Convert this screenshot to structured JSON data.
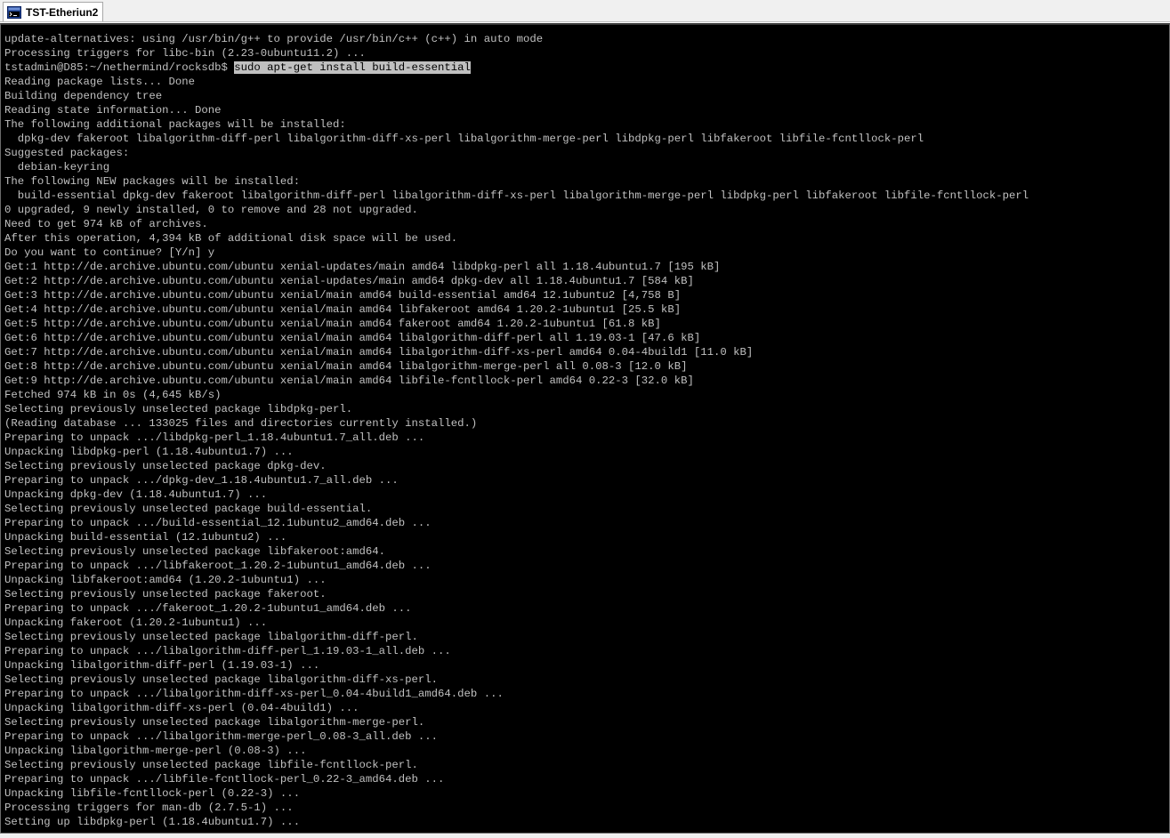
{
  "window": {
    "tab_title": "TST-Etheriun2",
    "tab_icon": "terminal-session-icon"
  },
  "colors": {
    "terminal_bg": "#000000",
    "terminal_fg": "#c0c0c0",
    "selection_bg": "#c0c0c0",
    "selection_fg": "#000000"
  },
  "terminal": {
    "prompt_line": {
      "prompt": "tstadmin@D85:~/nethermind/rocksdb$ ",
      "command": "sudo apt-get install build-essential"
    },
    "lines_before": [
      "update-alternatives: using /usr/bin/g++ to provide /usr/bin/c++ (c++) in auto mode",
      "Processing triggers for libc-bin (2.23-0ubuntu11.2) ..."
    ],
    "lines_after": [
      "Reading package lists... Done",
      "Building dependency tree",
      "Reading state information... Done",
      "The following additional packages will be installed:",
      "  dpkg-dev fakeroot libalgorithm-diff-perl libalgorithm-diff-xs-perl libalgorithm-merge-perl libdpkg-perl libfakeroot libfile-fcntllock-perl",
      "Suggested packages:",
      "  debian-keyring",
      "The following NEW packages will be installed:",
      "  build-essential dpkg-dev fakeroot libalgorithm-diff-perl libalgorithm-diff-xs-perl libalgorithm-merge-perl libdpkg-perl libfakeroot libfile-fcntllock-perl",
      "0 upgraded, 9 newly installed, 0 to remove and 28 not upgraded.",
      "Need to get 974 kB of archives.",
      "After this operation, 4,394 kB of additional disk space will be used.",
      "Do you want to continue? [Y/n] y",
      "Get:1 http://de.archive.ubuntu.com/ubuntu xenial-updates/main amd64 libdpkg-perl all 1.18.4ubuntu1.7 [195 kB]",
      "Get:2 http://de.archive.ubuntu.com/ubuntu xenial-updates/main amd64 dpkg-dev all 1.18.4ubuntu1.7 [584 kB]",
      "Get:3 http://de.archive.ubuntu.com/ubuntu xenial/main amd64 build-essential amd64 12.1ubuntu2 [4,758 B]",
      "Get:4 http://de.archive.ubuntu.com/ubuntu xenial/main amd64 libfakeroot amd64 1.20.2-1ubuntu1 [25.5 kB]",
      "Get:5 http://de.archive.ubuntu.com/ubuntu xenial/main amd64 fakeroot amd64 1.20.2-1ubuntu1 [61.8 kB]",
      "Get:6 http://de.archive.ubuntu.com/ubuntu xenial/main amd64 libalgorithm-diff-perl all 1.19.03-1 [47.6 kB]",
      "Get:7 http://de.archive.ubuntu.com/ubuntu xenial/main amd64 libalgorithm-diff-xs-perl amd64 0.04-4build1 [11.0 kB]",
      "Get:8 http://de.archive.ubuntu.com/ubuntu xenial/main amd64 libalgorithm-merge-perl all 0.08-3 [12.0 kB]",
      "Get:9 http://de.archive.ubuntu.com/ubuntu xenial/main amd64 libfile-fcntllock-perl amd64 0.22-3 [32.0 kB]",
      "Fetched 974 kB in 0s (4,645 kB/s)",
      "Selecting previously unselected package libdpkg-perl.",
      "(Reading database ... 133025 files and directories currently installed.)",
      "Preparing to unpack .../libdpkg-perl_1.18.4ubuntu1.7_all.deb ...",
      "Unpacking libdpkg-perl (1.18.4ubuntu1.7) ...",
      "Selecting previously unselected package dpkg-dev.",
      "Preparing to unpack .../dpkg-dev_1.18.4ubuntu1.7_all.deb ...",
      "Unpacking dpkg-dev (1.18.4ubuntu1.7) ...",
      "Selecting previously unselected package build-essential.",
      "Preparing to unpack .../build-essential_12.1ubuntu2_amd64.deb ...",
      "Unpacking build-essential (12.1ubuntu2) ...",
      "Selecting previously unselected package libfakeroot:amd64.",
      "Preparing to unpack .../libfakeroot_1.20.2-1ubuntu1_amd64.deb ...",
      "Unpacking libfakeroot:amd64 (1.20.2-1ubuntu1) ...",
      "Selecting previously unselected package fakeroot.",
      "Preparing to unpack .../fakeroot_1.20.2-1ubuntu1_amd64.deb ...",
      "Unpacking fakeroot (1.20.2-1ubuntu1) ...",
      "Selecting previously unselected package libalgorithm-diff-perl.",
      "Preparing to unpack .../libalgorithm-diff-perl_1.19.03-1_all.deb ...",
      "Unpacking libalgorithm-diff-perl (1.19.03-1) ...",
      "Selecting previously unselected package libalgorithm-diff-xs-perl.",
      "Preparing to unpack .../libalgorithm-diff-xs-perl_0.04-4build1_amd64.deb ...",
      "Unpacking libalgorithm-diff-xs-perl (0.04-4build1) ...",
      "Selecting previously unselected package libalgorithm-merge-perl.",
      "Preparing to unpack .../libalgorithm-merge-perl_0.08-3_all.deb ...",
      "Unpacking libalgorithm-merge-perl (0.08-3) ...",
      "Selecting previously unselected package libfile-fcntllock-perl.",
      "Preparing to unpack .../libfile-fcntllock-perl_0.22-3_amd64.deb ...",
      "Unpacking libfile-fcntllock-perl (0.22-3) ...",
      "Processing triggers for man-db (2.7.5-1) ...",
      "Setting up libdpkg-perl (1.18.4ubuntu1.7) ..."
    ]
  }
}
